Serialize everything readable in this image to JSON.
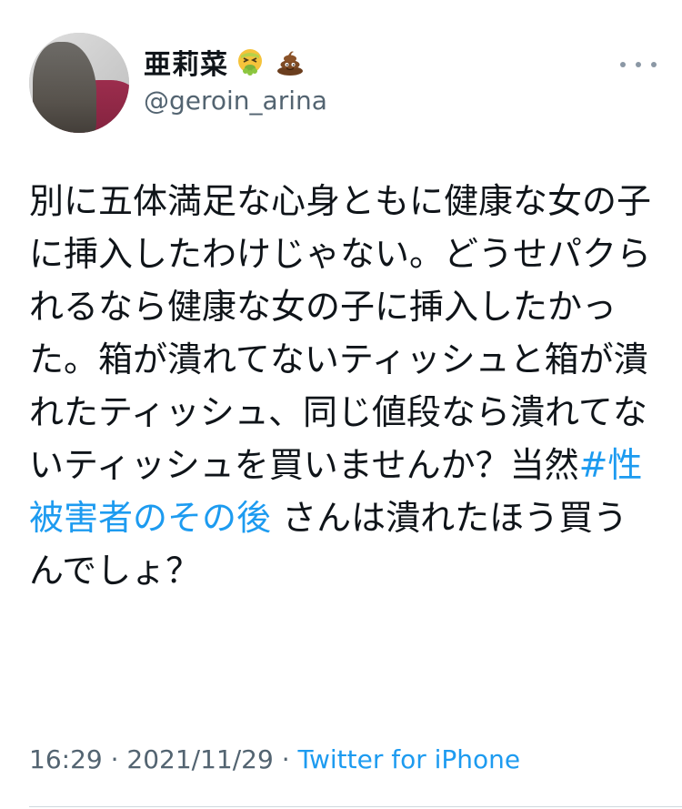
{
  "author": {
    "display_name": "亜莉菜",
    "handle": "@geroin_arina",
    "emoji_1": "nauseated-face-emoji",
    "emoji_2": "pile-of-poo-emoji"
  },
  "tweet": {
    "text_part1": "別に五体満足な心身ともに健康な女の子に挿入したわけじゃない。どうせパクられるなら健康な女の子に挿入したかった。箱が潰れてないティッシュと箱が潰れたティッシュ、同じ値段なら潰れてないティッシュを買いませんか？当然",
    "hashtag": "#性被害者のその後",
    "text_part2": "さんは潰れたほう買うんでしょ？"
  },
  "meta": {
    "time": "16:29",
    "separator1": " · ",
    "date": "2021/11/29",
    "separator2": " · ",
    "source": "Twitter for iPhone"
  },
  "colors": {
    "link": "#1d9bf0",
    "secondary": "#536471",
    "text": "#0f1419"
  }
}
